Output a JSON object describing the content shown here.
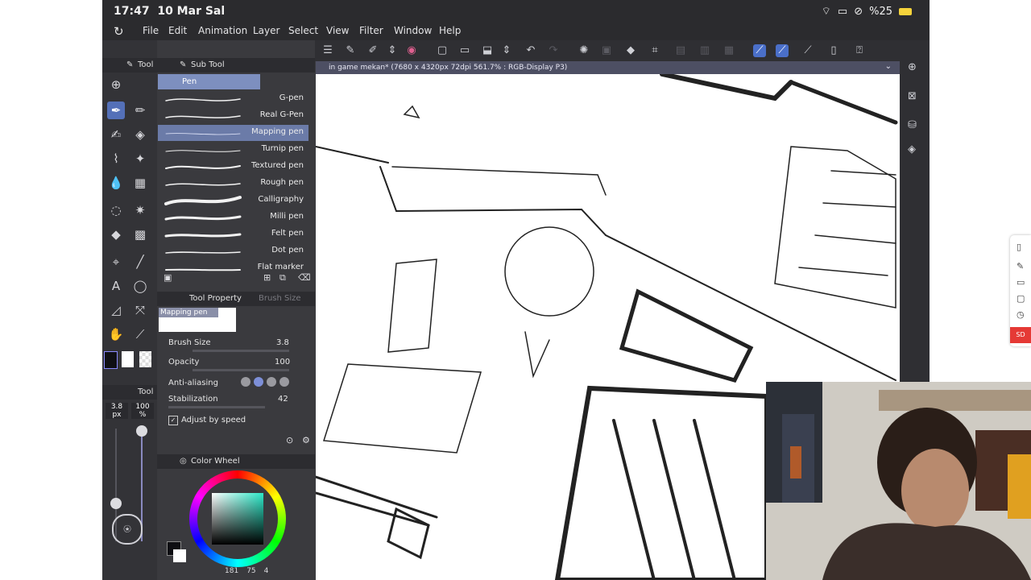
{
  "status_bar": {
    "time": "17:47",
    "date": "10 Mar Sal",
    "battery": "%25",
    "icons": [
      "wifi-icon",
      "screen-record-icon",
      "block-icon"
    ]
  },
  "menu": {
    "logo": "clip-studio-logo-icon",
    "items": [
      "File",
      "Edit",
      "Animation",
      "Layer",
      "Select",
      "View",
      "Filter",
      "Window",
      "Help"
    ]
  },
  "tool_panel": {
    "title": "Tool",
    "icons": [
      "download-icon",
      "pen-icon",
      "pencil-icon",
      "brush-icon",
      "eraser-icon",
      "fill-spray-icon",
      "sparkle-icon",
      "blend-icon",
      "pattern-icon",
      "lasso-icon",
      "wand-icon",
      "bucket-icon",
      "gradient-icon",
      "object-icon",
      "line-icon",
      "text-icon",
      "balloon-icon",
      "ruler-icon",
      "link-icon",
      "hand-icon",
      "eyedropper-icon"
    ],
    "color_swatches": [
      "#101014",
      "#ffffff",
      "transparent"
    ]
  },
  "brush_size_panel": {
    "title": "Tool",
    "size_value": "3.8",
    "size_unit": "px",
    "opacity_value": "100",
    "opacity_unit": "%"
  },
  "sub_tool": {
    "title": "Sub Tool",
    "group_tab": "Pen",
    "brushes": [
      {
        "name": "G-pen",
        "selected": false
      },
      {
        "name": "Real G-Pen",
        "selected": false
      },
      {
        "name": "Mapping pen",
        "selected": true
      },
      {
        "name": "Turnip pen",
        "selected": false
      },
      {
        "name": "Textured pen",
        "selected": false
      },
      {
        "name": "Rough pen",
        "selected": false
      },
      {
        "name": "Calligraphy",
        "selected": false
      },
      {
        "name": "Milli pen",
        "selected": false
      },
      {
        "name": "Felt pen",
        "selected": false
      },
      {
        "name": "Dot pen",
        "selected": false
      },
      {
        "name": "Flat marker",
        "selected": false
      }
    ]
  },
  "tool_property": {
    "tabs": [
      "Tool Property",
      "Brush Size"
    ],
    "preview_label": "Mapping pen",
    "brush_size_label": "Brush Size",
    "brush_size_value": "3.8",
    "opacity_label": "Opacity",
    "opacity_value": "100",
    "anti_aliasing_label": "Anti-aliasing",
    "stabilization_label": "Stabilization",
    "stabilization_value": "42",
    "adjust_by_speed_label": "Adjust by speed"
  },
  "color_wheel": {
    "title": "Color Wheel",
    "hue_color": "#2ce8c8",
    "readout": "181",
    "readout2": "75",
    "readout3": "4"
  },
  "document": {
    "tab_title": "in game mekan* (7680 x 4320px 72dpi 561.7% : RGB-Display P3)"
  },
  "webcam": {
    "description": ""
  },
  "colors": {
    "accent": "#5470b8",
    "selected_row": "#6b7ba8",
    "panel_bg": "#3a3a3e",
    "doc_tab": "#4d4f63",
    "record_badge": "#e53935"
  }
}
